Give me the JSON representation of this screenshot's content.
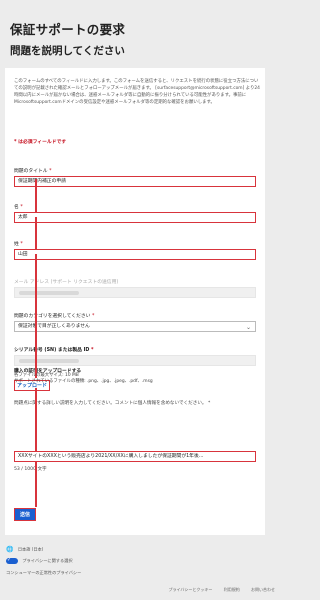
{
  "page": {
    "title": "保証サポートの要求",
    "subtitle": "問題を説明してください"
  },
  "intro": "このフォームのすべてのフィールドに入力します。このフォームを送信すると、リクエストを続行の状態に役立つ方法についての説明が記載された確認メールとフォローアップメールが届きます。 [surfacesupport@microsoftsupport.com] より24時間以内にメールが届かない場合は、迷惑メールフォルダ等に自動的に振り分けられている可能性があります。事前にMicrosoftsupport.comドメインの受信設定や迷惑メールフォルダ等の定期的な確認をお願いします。",
  "required_note": "* は必須フィールドです",
  "fields": {
    "title_label": "問題のタイトル",
    "title_value": "保証期間内補正の申請",
    "first_name_label": "名",
    "first_name_value": "太郎",
    "last_name_label": "姓",
    "last_name_value": "山田",
    "email_label": "メール アドレス (サポート リクエストの送信用)",
    "category_label": "問題のカテゴリを選択してください",
    "category_value": "保証対象で目が正しくありません",
    "serial_label": "シリアル番号 (SN) または製品 ID",
    "required_mark": "*"
  },
  "attachment": {
    "label": "購入の証明をアップロードする",
    "max_size": "各ファイルの最大サイズ: 10 MB",
    "types": "サポートされているファイルの種類: .png、.jpg、.jpeg、.pdf、.msg",
    "upload_button": "アップロード"
  },
  "description": {
    "label": "問題点に関する詳しい説明を入力してください。コメントに個人情報を含めないでください。",
    "value": "XXXサイトのXXXという販売店より2021/XX/XXに購入しましたが保証期間が1年後…",
    "counter": "53 / 1000 文字"
  },
  "submit_label": "送信",
  "footer": {
    "language": "日本語 (日本)",
    "privacy_choices": "プライバシーに関する選択",
    "consumer_health": "コンシューマーの正常性のプライバシー",
    "links": [
      "プライバシーとクッキー",
      "利用規約",
      "お問い合わせ"
    ]
  },
  "colors": {
    "accent": "#1a5fd0",
    "highlight": "#d8343c",
    "required": "#c50f1f"
  },
  "icons": {
    "globe": "globe-icon",
    "privacy": "privacy-toggle-icon",
    "chevron": "chevron-down-icon"
  }
}
